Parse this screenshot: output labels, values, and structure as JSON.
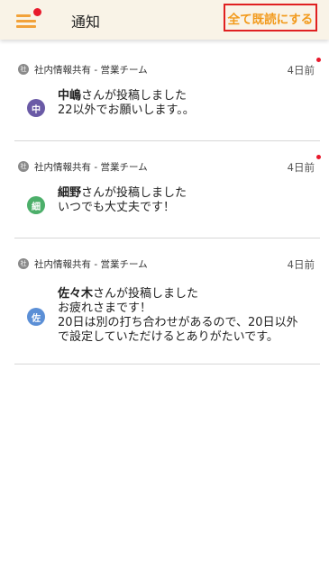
{
  "header": {
    "title": "通知",
    "mark_all_read": "全て既読にする",
    "menu_icon": "hamburger-menu-icon",
    "menu_has_badge": true
  },
  "colors": {
    "accent": "#f29a1c",
    "unread": "#e8192c",
    "header_bg": "#f9f3e7"
  },
  "notifications": [
    {
      "channel_icon": "社",
      "channel": "社内情報共有 - 営業チーム",
      "time": "4日前",
      "unread": true,
      "avatar": "中",
      "avatar_color": "#6a5aa6",
      "author": "中嶋",
      "action": "さんが投稿しました",
      "message": "22以外でお願いします。。"
    },
    {
      "channel_icon": "社",
      "channel": "社内情報共有 - 営業チーム",
      "time": "4日前",
      "unread": true,
      "avatar": "細",
      "avatar_color": "#4caf6a",
      "author": "細野",
      "action": "さんが投稿しました",
      "message": "いつでも大丈夫です！"
    },
    {
      "channel_icon": "社",
      "channel": "社内情報共有 - 営業チーム",
      "time": "4日前",
      "unread": false,
      "avatar": "佐",
      "avatar_color": "#5b8fd6",
      "author": "佐々木",
      "action": "さんが投稿しました",
      "message_lines": [
        "お疲れさまです！",
        "20日は別の打ち合わせがあるので、20日以外",
        "で設定していただけるとありがたいです。"
      ]
    }
  ]
}
